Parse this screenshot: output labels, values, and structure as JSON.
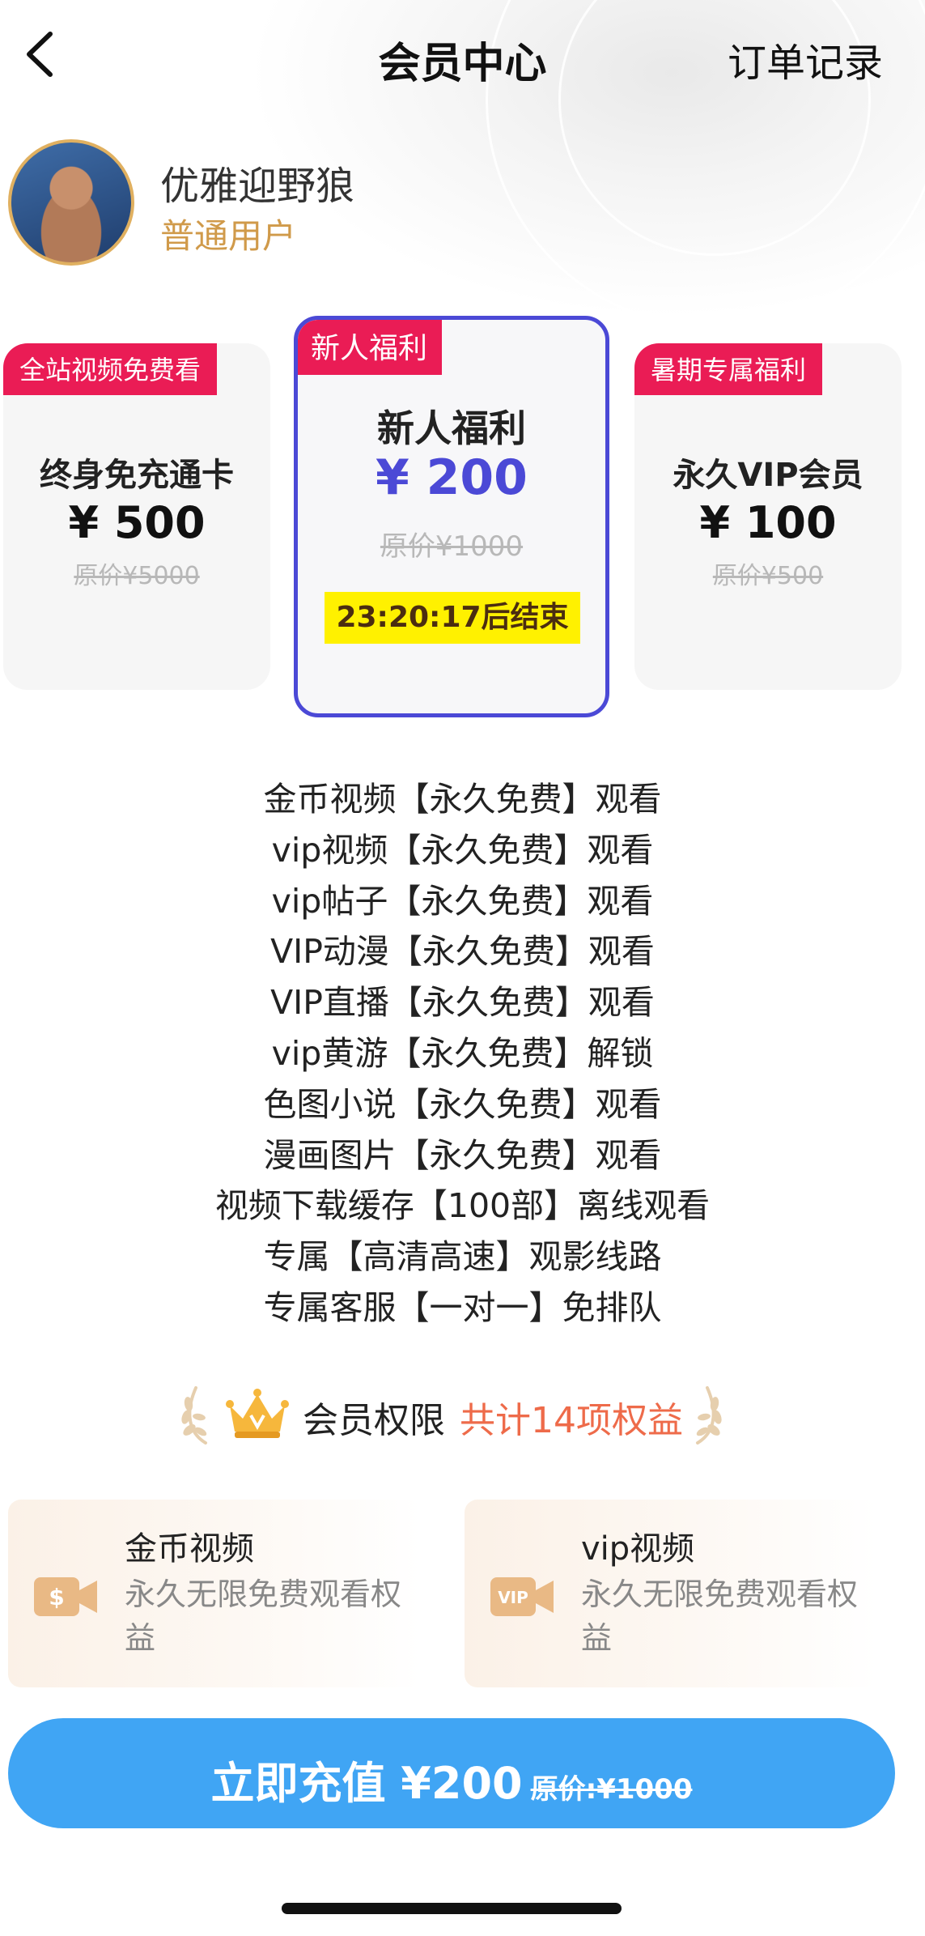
{
  "header": {
    "title": "会员中心",
    "orders_label": "订单记录"
  },
  "user": {
    "name": "优雅迎野狼",
    "level": "普通用户"
  },
  "plans": [
    {
      "tag": "全站视频免费看",
      "name": "终身免充通卡",
      "price": "¥ 500",
      "original": "原价¥5000"
    },
    {
      "tag": "新人福利",
      "name": "新人福利",
      "price": "¥ 200",
      "original": "原价¥1000",
      "countdown": "23:20:17后结束",
      "selected": true
    },
    {
      "tag": "暑期专属福利",
      "name": "永久VIP会员",
      "price": "¥ 100",
      "original": "原价¥500"
    }
  ],
  "benefits": [
    "金币视频【永久免费】观看",
    "vip视频【永久免费】观看",
    "vip帖子【永久免费】观看",
    "VIP动漫【永久免费】观看",
    "VIP直播【永久免费】观看",
    "vip黄游【永久免费】解锁",
    "色图小说【永久免费】观看",
    "漫画图片【永久免费】观看",
    "视频下载缓存【100部】离线观看",
    "专属【高清高速】观影线路",
    "专属客服【一对一】免排队"
  ],
  "privileges": {
    "label": "会员权限",
    "count_text": "共计14项权益",
    "items": [
      {
        "title": "金币视频",
        "desc": "永久无限免费观看权益",
        "icon": "coin-video-icon",
        "icon_text": "$"
      },
      {
        "title": "vip视频",
        "desc": "永久无限免费观看权益",
        "icon": "vip-video-icon",
        "icon_text": "VIP"
      }
    ]
  },
  "recharge": {
    "label": "立即充值 ¥200",
    "original": "原价:¥1000"
  },
  "colors": {
    "accent_purple": "#4b49d6",
    "tag_red": "#ea1c55",
    "button_blue": "#40a5f4",
    "level_gold": "#d09a4a",
    "count_orange": "#ee6b4a",
    "countdown_yellow": "#fff100"
  }
}
